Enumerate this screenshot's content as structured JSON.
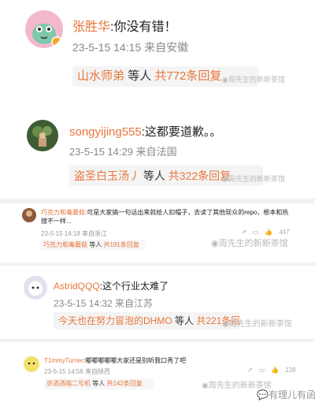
{
  "comments": [
    {
      "username": "张胜华",
      "text": ":你没有错！",
      "meta": "23-5-15 14:15 来自安徽",
      "reply_name": "山水师弟",
      "reply_mid": "等人",
      "reply_count": "共772条回复",
      "watermark": "周先生的新新茶馆"
    },
    {
      "username": "songyijing555",
      "text": ":这都要道歉。。",
      "meta": "23-5-15 14:29 来自法国",
      "reply_name": "盗圣白玉汤丿",
      "reply_mid": "等人",
      "reply_count": "共322条回复",
      "watermark": "周先生的新新茶馆"
    },
    {
      "username": "巧克力和毒蘑菇",
      "text": ":可是大家搞一句话出来就给人扣帽子，去读了其他现众的repo，根本和热搜不一样...",
      "meta": "23-5-15 14:18 来自浙江",
      "reply_name": "巧克力和毒蘑菇",
      "reply_mid": "等人",
      "reply_count": "共191条回复",
      "like_count": "447",
      "watermark": "周先生的新新茶馆"
    },
    {
      "username": "AstridQQQ",
      "text": ":这个行业太难了",
      "meta": "23-5-15 14:32 来自江苏",
      "reply_name": "今天也在努力冒泡的DHMO",
      "reply_mid": "等人",
      "reply_count": "共221条回复",
      "watermark": "周先生的新新茶馆"
    },
    {
      "username": "T1mmyTurner",
      "text": ":嘟嘟嘟嘟嘟大家还是别听我口秀了吧",
      "meta": "23-5-15 14:56 来自陕西",
      "reply_name": "亦酒酒喵二号机",
      "reply_mid": "等人",
      "reply_count": "共142条回复",
      "like_count": "138",
      "watermark": "周先生的新新茶馆"
    }
  ],
  "footer_watermark": "有理儿有函"
}
